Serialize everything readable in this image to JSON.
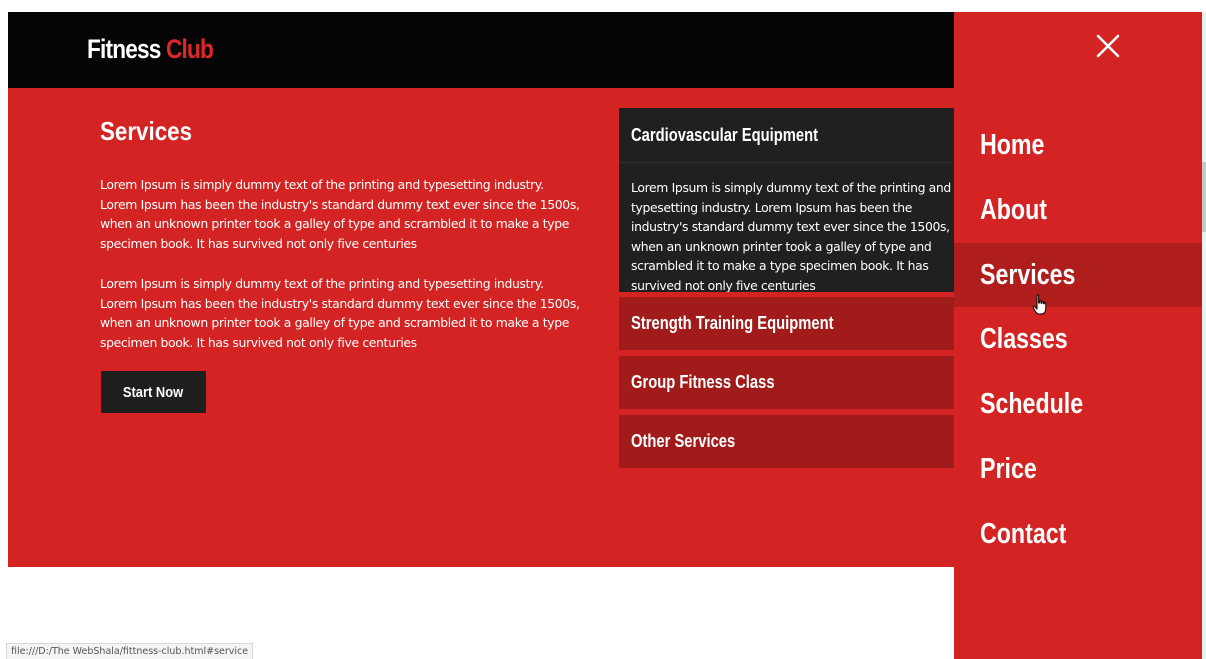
{
  "header": {
    "logo_main": "Fitness",
    "logo_accent": "Club"
  },
  "services": {
    "title": "Services",
    "paragraphs": [
      "Lorem Ipsum is simply dummy text of the printing and typesetting industry. Lorem Ipsum has been the industry's standard dummy text ever since the 1500s, when an unknown printer took a galley of type and scrambled it to make a type specimen book. It has survived not only five centuries",
      "Lorem Ipsum is simply dummy text of the printing and typesetting industry. Lorem Ipsum has been the industry's standard dummy text ever since the 1500s, when an unknown printer took a galley of type and scrambled it to make a type specimen book. It has survived not only five centuries"
    ],
    "cta_label": "Start Now"
  },
  "accordion": {
    "open_item": {
      "title": "Cardiovascular Equipment",
      "body": "Lorem Ipsum is simply dummy text of the printing and typesetting industry. Lorem Ipsum has been the industry's standard dummy text ever since the 1500s, when an unknown printer took a galley of type and scrambled it to make a type specimen book. It has survived not only five centuries"
    },
    "items": [
      {
        "title": "Strength Training Equipment"
      },
      {
        "title": "Group Fitness Class"
      },
      {
        "title": "Other Services"
      }
    ]
  },
  "side_menu": {
    "close_icon": "close-icon",
    "items": [
      {
        "label": "Home"
      },
      {
        "label": "About"
      },
      {
        "label": "Services",
        "active": true
      },
      {
        "label": "Classes"
      },
      {
        "label": "Schedule"
      },
      {
        "label": "Price"
      },
      {
        "label": "Contact"
      }
    ]
  },
  "status_bar": {
    "url": "file:///D:/The WebShala/fittness-club.html#service"
  },
  "colors": {
    "brand_red": "#d32323",
    "accent_red": "#e02626",
    "dark": "#050505",
    "panel_dark": "#202020",
    "collapsed_item": "#a11b1b",
    "menu_active": "#b01d1d"
  }
}
